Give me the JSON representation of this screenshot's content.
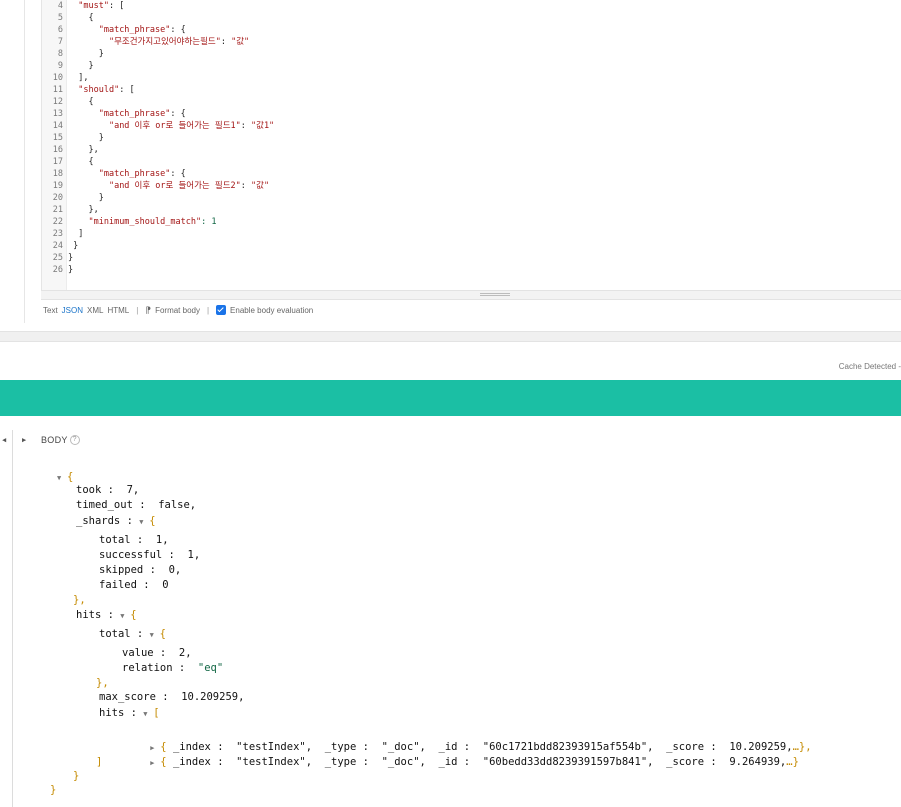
{
  "editor": {
    "lines": [
      {
        "num": "4",
        "text": "  \"must\": ["
      },
      {
        "num": "5",
        "text": "    {"
      },
      {
        "num": "6",
        "text": "      \"match_phrase\": {"
      },
      {
        "num": "7",
        "text": "        \"무조건가지고있어야하는필드\": \"값\""
      },
      {
        "num": "8",
        "text": "      }"
      },
      {
        "num": "9",
        "text": "    }"
      },
      {
        "num": "10",
        "text": "  ],"
      },
      {
        "num": "11",
        "text": "  \"should\": ["
      },
      {
        "num": "12",
        "text": "    {"
      },
      {
        "num": "13",
        "text": "      \"match_phrase\": {"
      },
      {
        "num": "14",
        "text": "        \"and 이후 or로 들어가는 필드1\": \"값1\""
      },
      {
        "num": "15",
        "text": "      }"
      },
      {
        "num": "16",
        "text": "    },"
      },
      {
        "num": "17",
        "text": "    {"
      },
      {
        "num": "18",
        "text": "      \"match_phrase\": {"
      },
      {
        "num": "19",
        "text": "        \"and 이후 or로 들어가는 필드2\": \"값\""
      },
      {
        "num": "20",
        "text": "      }"
      },
      {
        "num": "21",
        "text": "    },"
      },
      {
        "num": "22",
        "text": "    \"minimum_should_match\": 1"
      },
      {
        "num": "23",
        "text": "  ]"
      },
      {
        "num": "24",
        "text": " }"
      },
      {
        "num": "25",
        "text": "}"
      },
      {
        "num": "26",
        "text": "}"
      }
    ]
  },
  "toolbar": {
    "text": "Text",
    "json": "JSON",
    "xml": "XML",
    "html": "HTML",
    "format_body": "Format body",
    "enable_eval": "Enable body evaluation"
  },
  "cache_note": "Cache Detected - ",
  "body_label": "BODY",
  "help_glyph": "?",
  "response": {
    "open": "{",
    "took_key": "took",
    "took_val": "7,",
    "timed_out_key": "timed_out",
    "timed_out_val": "false,",
    "shards_key": "_shards",
    "shards_total_key": "total",
    "shards_total_val": "1,",
    "successful_key": "successful",
    "successful_val": "1,",
    "skipped_key": "skipped",
    "skipped_val": "0,",
    "failed_key": "failed",
    "failed_val": "0",
    "close_obj_comma": "},",
    "hits_key": "hits",
    "hits_total_key": "total",
    "value_key": "value",
    "value_val": "2,",
    "relation_key": "relation",
    "relation_val": "\"eq\"",
    "max_score_key": "max_score",
    "max_score_val": "10.209259,",
    "hits_arr_key": "hits",
    "hit_rows": [
      {
        "index": "\"testIndex\",",
        "type": "\"_doc\",",
        "id": "\"60c1721bdd82393915af554b\",",
        "score": "10.209259,",
        "tail": "…},"
      },
      {
        "index": "\"testIndex\",",
        "type": "\"_doc\",",
        "id": "\"60bedd33dd8239391597b841\",",
        "score": "9.264939,",
        "tail": "…}"
      }
    ],
    "close_arr": "]",
    "close_obj": "}",
    "close_root": "}"
  }
}
